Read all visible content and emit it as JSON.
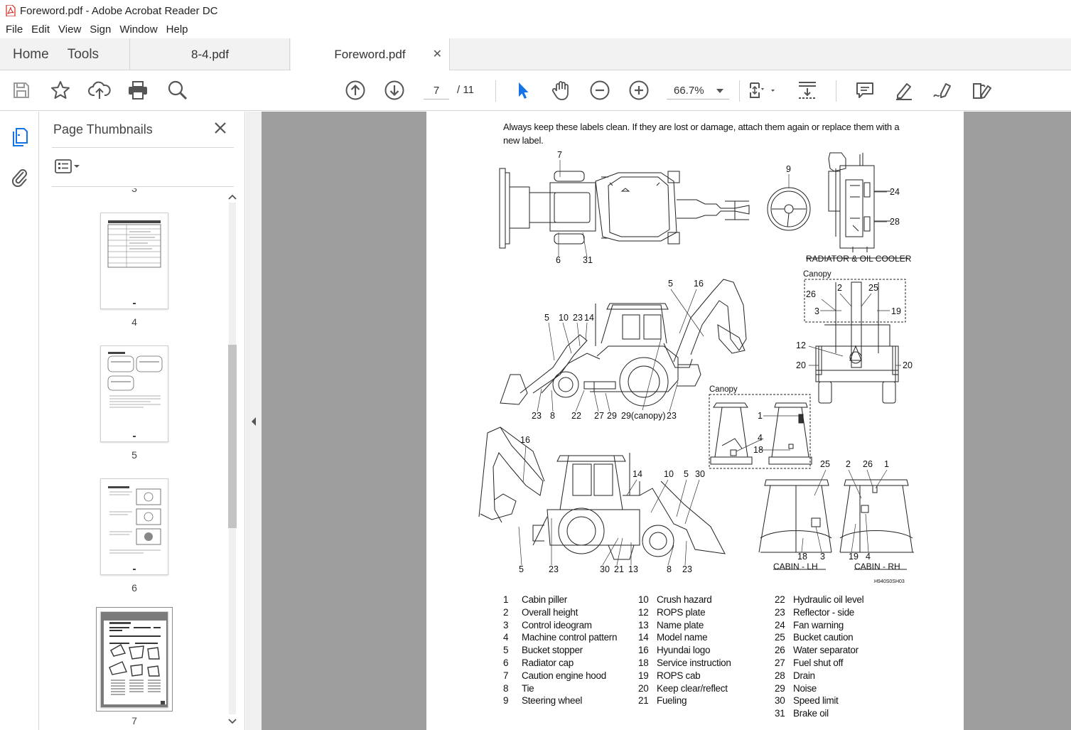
{
  "window": {
    "title": "Foreword.pdf - Adobe Acrobat Reader DC"
  },
  "menu": [
    "File",
    "Edit",
    "View",
    "Sign",
    "Window",
    "Help"
  ],
  "nav": {
    "home": "Home",
    "tools": "Tools"
  },
  "tabs": [
    {
      "label": "8-4.pdf",
      "active": false
    },
    {
      "label": "Foreword.pdf",
      "active": true
    }
  ],
  "toolbar": {
    "current_page": "7",
    "total_pages": "/ 11",
    "zoom": "66.7%"
  },
  "panel": {
    "title": "Page Thumbnails",
    "top_partial_label": "3",
    "thumbnails": [
      {
        "label": "4",
        "selected": false
      },
      {
        "label": "5",
        "selected": false
      },
      {
        "label": "6",
        "selected": false
      },
      {
        "label": "7",
        "selected": true
      }
    ]
  },
  "document": {
    "intro": "Always keep these labels clean. If they are lost or damage, attach them again or replace them with a new label.",
    "diagram_labels": {
      "radiator": "RADIATOR & OIL COOLER",
      "canopy": "Canopy",
      "cabin_lh": "CABIN - LH",
      "cabin_rh": "CABIN - RH",
      "figure_id": "H940S0SH03",
      "canopy_callout": "29(canopy)"
    },
    "legend_col1": [
      {
        "num": "1",
        "text": "Cabin piller"
      },
      {
        "num": "2",
        "text": "Overall height"
      },
      {
        "num": "3",
        "text": "Control ideogram"
      },
      {
        "num": "4",
        "text": "Machine control pattern"
      },
      {
        "num": "5",
        "text": "Bucket stopper"
      },
      {
        "num": "6",
        "text": "Radiator cap"
      },
      {
        "num": "7",
        "text": "Caution engine hood"
      },
      {
        "num": "8",
        "text": "Tie"
      },
      {
        "num": "9",
        "text": "Steering wheel"
      }
    ],
    "legend_col2": [
      {
        "num": "10",
        "text": "Crush hazard"
      },
      {
        "num": "12",
        "text": "ROPS plate"
      },
      {
        "num": "13",
        "text": "Name plate"
      },
      {
        "num": "14",
        "text": "Model name"
      },
      {
        "num": "16",
        "text": "Hyundai logo"
      },
      {
        "num": "18",
        "text": "Service instruction"
      },
      {
        "num": "19",
        "text": "ROPS cab"
      },
      {
        "num": "20",
        "text": "Keep clear/reflect"
      },
      {
        "num": "21",
        "text": "Fueling"
      }
    ],
    "legend_col3": [
      {
        "num": "22",
        "text": "Hydraulic oil level"
      },
      {
        "num": "23",
        "text": "Reflector - side"
      },
      {
        "num": "24",
        "text": "Fan warning"
      },
      {
        "num": "25",
        "text": "Bucket caution"
      },
      {
        "num": "26",
        "text": "Water separator"
      },
      {
        "num": "27",
        "text": "Fuel shut off"
      },
      {
        "num": "28",
        "text": "Drain"
      },
      {
        "num": "29",
        "text": "Noise"
      },
      {
        "num": "30",
        "text": "Speed limit"
      },
      {
        "num": "31",
        "text": "Brake oil"
      }
    ]
  },
  "colors": {
    "accent": "#1473e6",
    "pdf_red": "#d4251c",
    "doc_bg": "#9e9e9e"
  }
}
